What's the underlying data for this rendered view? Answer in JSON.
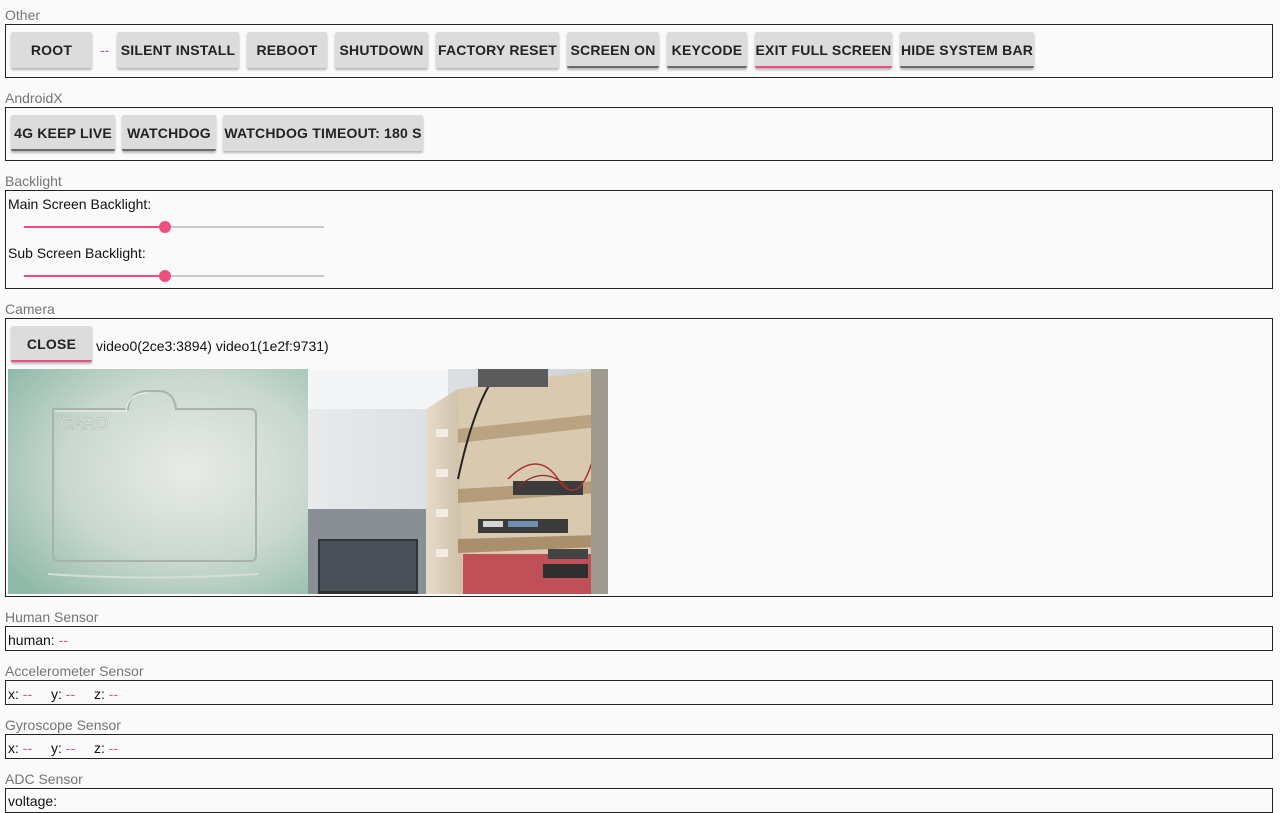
{
  "sections": {
    "other": {
      "label": "Other",
      "root_button": "ROOT",
      "root_status": "--",
      "silent_install_button": "SILENT INSTALL",
      "reboot_button": "REBOOT",
      "shutdown_button": "SHUTDOWN",
      "factory_reset_button": "FACTORY RESET",
      "screen_on_button": "SCREEN ON",
      "keycode_button": "KEYCODE",
      "exit_full_screen_button": "EXIT FULL SCREEN",
      "hide_system_bar_button": "HIDE SYSTEM BAR"
    },
    "androidx": {
      "label": "AndroidX",
      "keep_live_button": "4G KEEP LIVE",
      "watchdog_button": "WATCHDOG",
      "watchdog_timeout_button": "WATCHDOG TIMEOUT: 180 S"
    },
    "backlight": {
      "label": "Backlight",
      "main_label": "Main Screen Backlight:",
      "main_level": 0.47,
      "sub_label": "Sub Screen Backlight:",
      "sub_level": 0.47
    },
    "camera": {
      "label": "Camera",
      "close_button": "CLOSE",
      "devices": "video0(2ce3:3894) video1(1e2f:9731)",
      "card_text": "CARD"
    },
    "human": {
      "label": "Human Sensor",
      "key": "human:",
      "value": "--"
    },
    "accelerometer": {
      "label": "Accelerometer Sensor",
      "x_key": "x:",
      "x_value": "--",
      "y_key": "y:",
      "y_value": "--",
      "z_key": "z:",
      "z_value": "--"
    },
    "gyroscope": {
      "label": "Gyroscope Sensor",
      "x_key": "x:",
      "x_value": "--",
      "y_key": "y:",
      "y_value": "--",
      "z_key": "z:",
      "z_value": "--"
    },
    "adc": {
      "label": "ADC Sensor",
      "key": "voltage:"
    }
  },
  "colors": {
    "accent": "#ef4f7f",
    "button_bg": "#dcdcdc",
    "background": "#fafafa",
    "section_label": "#757575"
  }
}
